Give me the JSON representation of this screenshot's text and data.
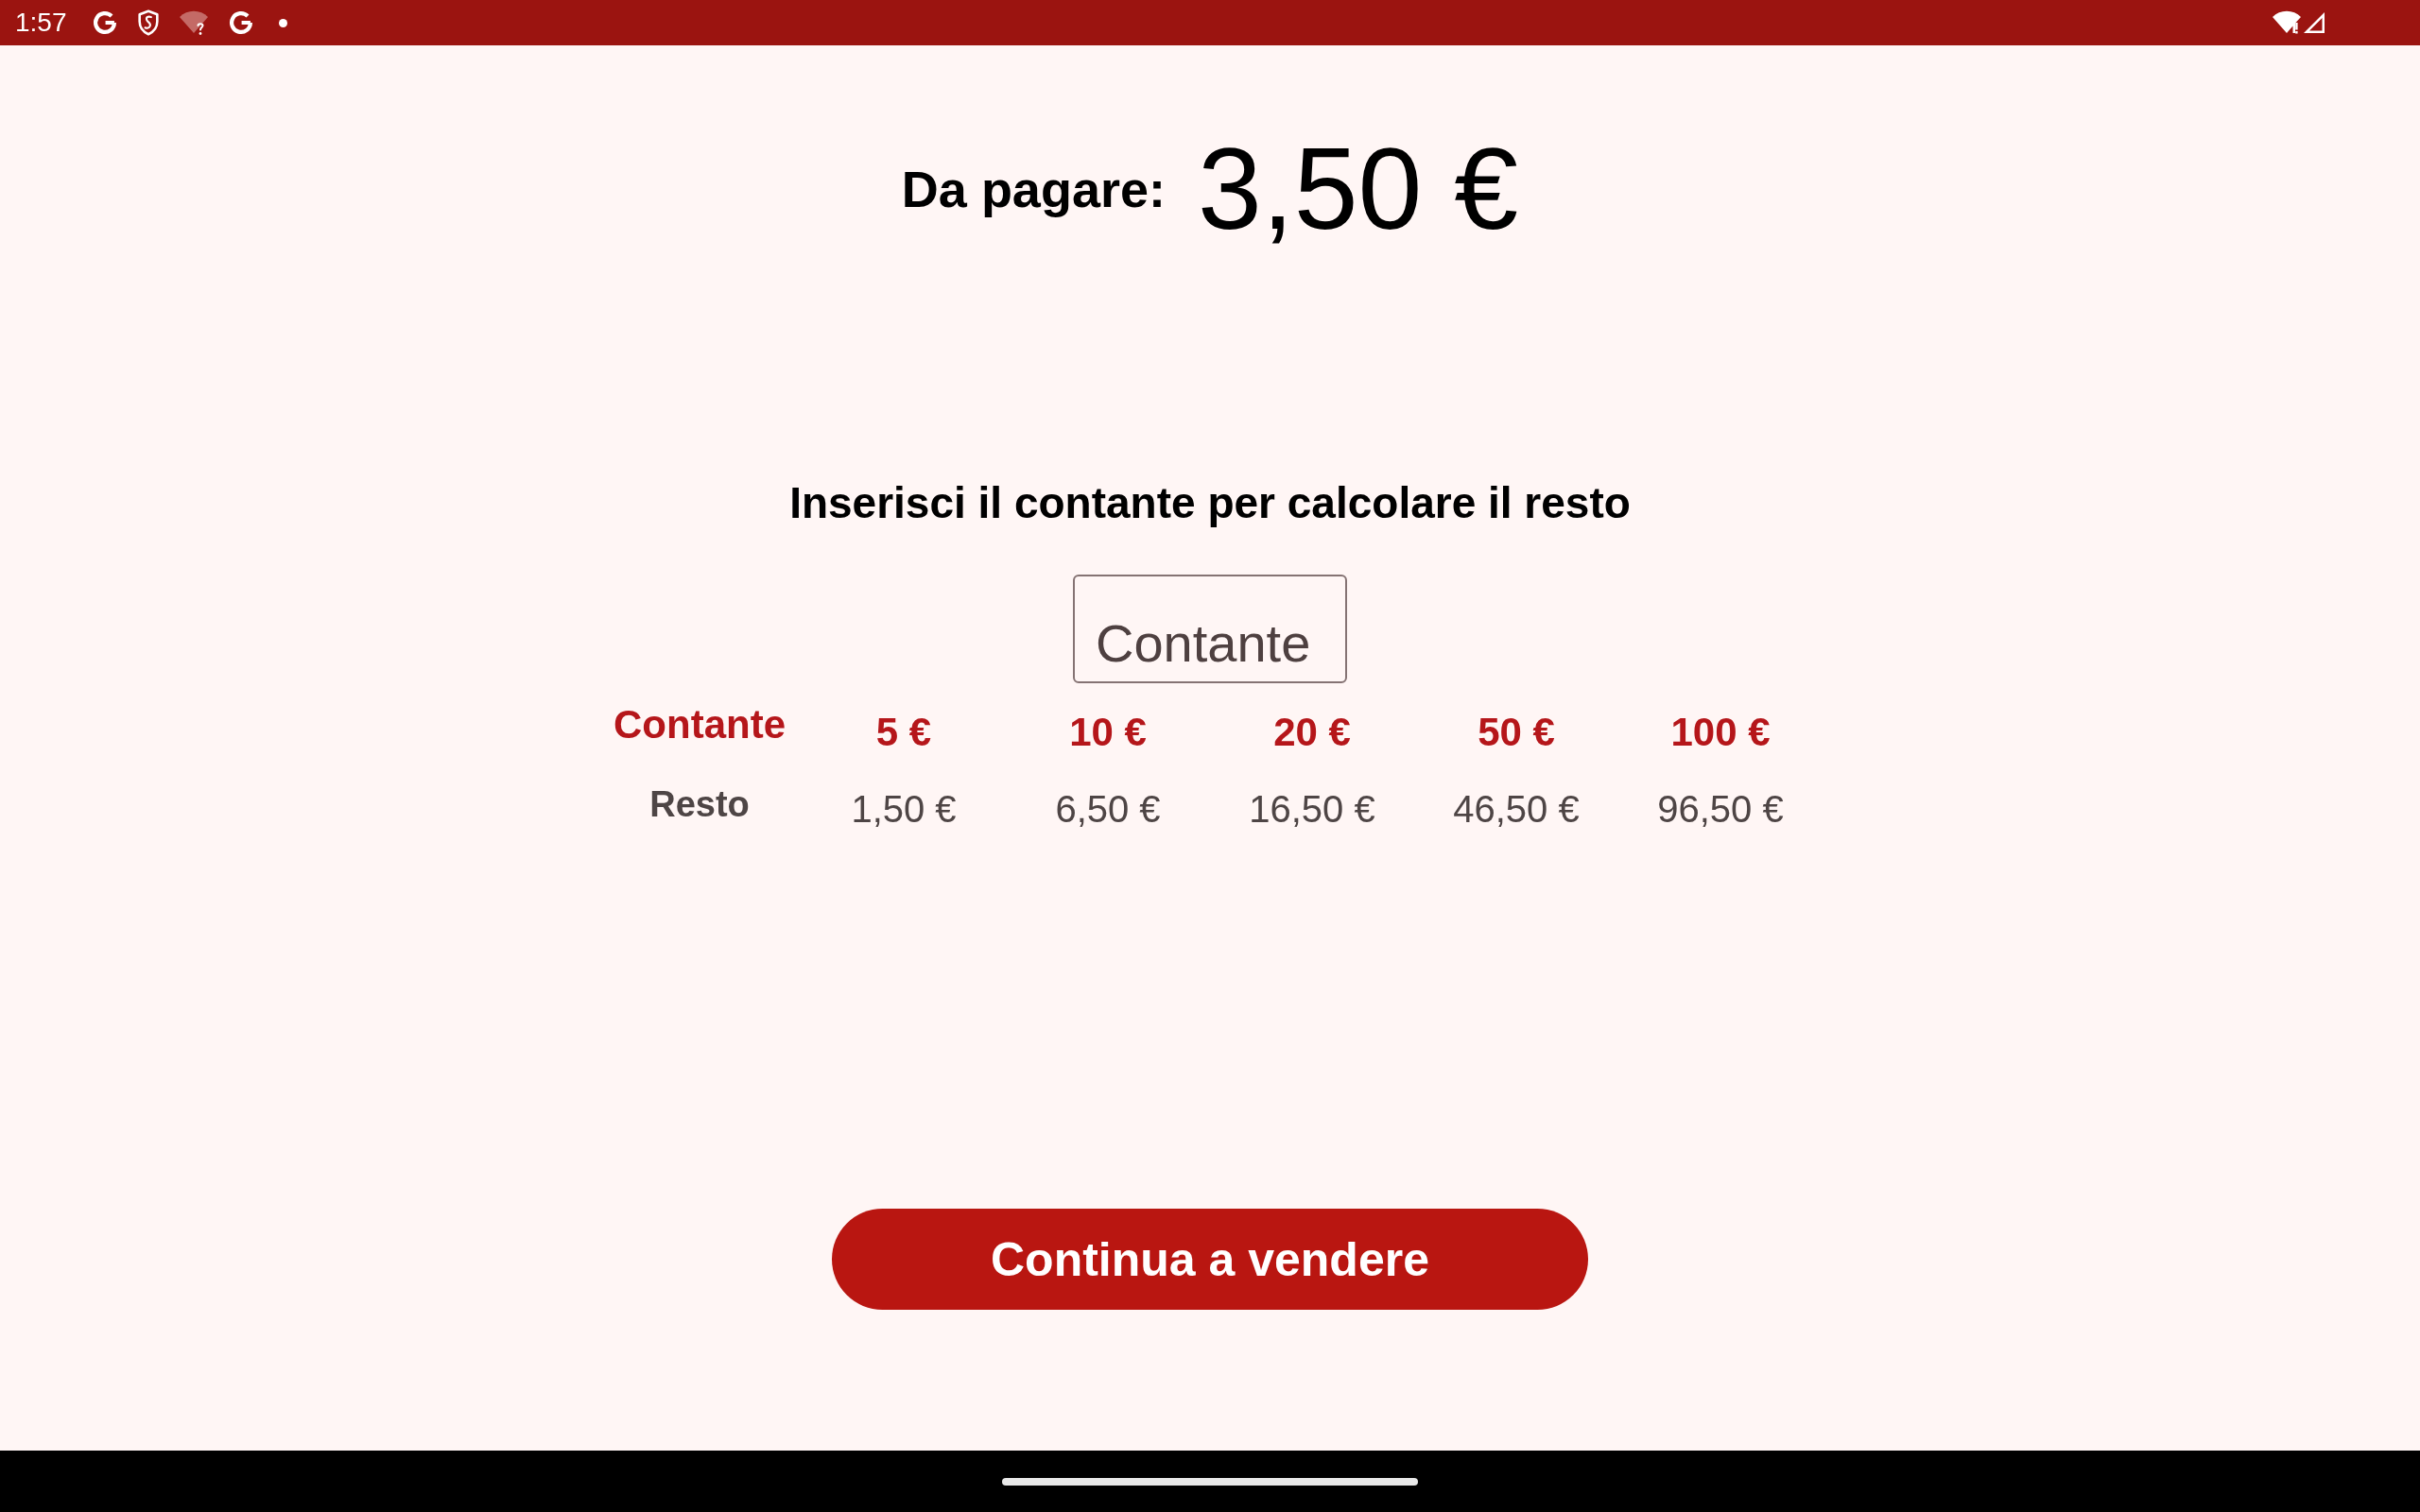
{
  "status_bar": {
    "time": "1:57"
  },
  "header": {
    "label": "Da pagare:",
    "amount": "3,50 €"
  },
  "cash_section": {
    "prompt": "Inserisci il contante per calcolare il resto",
    "cash_field": {
      "placeholder": "Contante"
    }
  },
  "change_table": {
    "cash_label": "Contante",
    "change_label": "Resto",
    "columns": [
      {
        "cash": "5 €",
        "change": "1,50 €"
      },
      {
        "cash": "10 €",
        "change": "6,50 €"
      },
      {
        "cash": "20 €",
        "change": "16,50 €"
      },
      {
        "cash": "50 €",
        "change": "46,50 €"
      },
      {
        "cash": "100 €",
        "change": "96,50 €"
      }
    ]
  },
  "continue_button": {
    "label": "Continua a vendere"
  }
}
